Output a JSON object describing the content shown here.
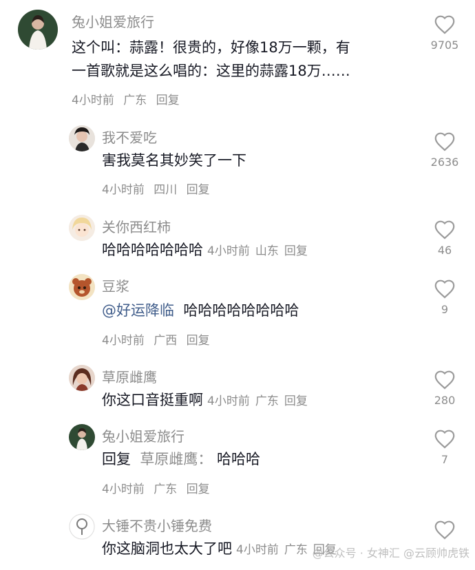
{
  "comments": [
    {
      "username": "兔小姐爱旅行",
      "text_line1": "这个叫：蒜露！很贵的，好像18万一颗，有",
      "text_line2": "一首歌就是这么唱的：这里的蒜露18万……",
      "time": "4小时前",
      "location": "广东",
      "reply": "回复",
      "likes": "9705"
    },
    {
      "username": "我不爱吃",
      "text": "害我莫名其妙笑了一下",
      "time": "4小时前",
      "location": "四川",
      "reply": "回复",
      "likes": "2636"
    },
    {
      "username": "关你西红柿",
      "text": "哈哈哈哈哈哈哈",
      "time": "4小时前",
      "location": "山东",
      "reply": "回复",
      "likes": "46"
    },
    {
      "username": "豆浆",
      "mention": "@好运降临",
      "text": "哈哈哈哈哈哈哈哈",
      "time": "4小时前",
      "location": "广西",
      "reply": "回复",
      "likes": "9"
    },
    {
      "username": "草原雌鹰",
      "text": "你这口音挺重啊",
      "time": "4小时前",
      "location": "广东",
      "reply": "回复",
      "likes": "280"
    },
    {
      "username": "兔小姐爱旅行",
      "reply_prefix": "回复",
      "reply_target": "草原雌鹰：",
      "text": "哈哈哈",
      "time": "4小时前",
      "location": "广东",
      "reply": "回复",
      "likes": "7"
    },
    {
      "username": "大锤不贵小锤免费",
      "text": "你这脑洞也太大了吧",
      "time": "4小时前",
      "location": "广东",
      "reply": "回复"
    }
  ],
  "watermark": "@公众号 · 女神汇  @云顾帅虎铁",
  "colors": {
    "username": "#8c8c8c",
    "text": "#161823",
    "mention": "#3f5c8a",
    "heart": "#9a9a9a"
  }
}
